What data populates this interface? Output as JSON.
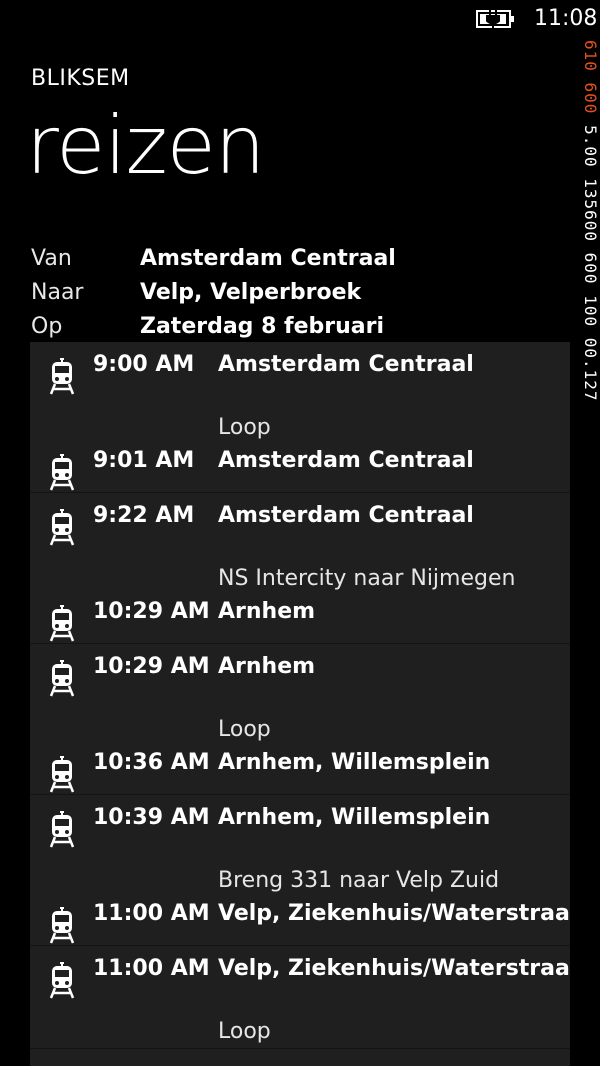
{
  "status": {
    "time": "11:08"
  },
  "side_debug": {
    "accent": "610 600 ",
    "normal": "5.00 135600 600 100 00.127 "
  },
  "app": {
    "name": "BLIKSEM",
    "title": "reizen"
  },
  "trip": {
    "from_label": "Van",
    "from_value": "Amsterdam Centraal",
    "to_label": "Naar",
    "to_value": "Velp, Velperbroek",
    "date_label": "Op",
    "date_value": "Zaterdag 8 februari"
  },
  "legs": [
    {
      "dep_time": "9:00 AM",
      "dep_stop": "Amsterdam Centraal",
      "mode": "Loop",
      "arr_time": "9:01 AM",
      "arr_stop": "Amsterdam Centraal"
    },
    {
      "dep_time": "9:22 AM",
      "dep_stop": "Amsterdam Centraal",
      "mode": "NS Intercity naar Nijmegen",
      "arr_time": "10:29 AM",
      "arr_stop": "Arnhem"
    },
    {
      "dep_time": "10:29 AM",
      "dep_stop": "Arnhem",
      "mode": "Loop",
      "arr_time": "10:36 AM",
      "arr_stop": "Arnhem, Willemsplein"
    },
    {
      "dep_time": "10:39 AM",
      "dep_stop": "Arnhem, Willemsplein",
      "mode": "Breng 331 naar Velp Zuid",
      "arr_time": "11:00 AM",
      "arr_stop": "Velp, Ziekenhuis/Waterstraat"
    },
    {
      "dep_time": "11:00 AM",
      "dep_stop": "Velp, Ziekenhuis/Waterstraat",
      "mode": "Loop"
    }
  ],
  "icons": {
    "transit": "train-icon",
    "battery": "battery-charging-icon"
  },
  "colors": {
    "background": "#000000",
    "panel": "#1f1f1f",
    "accent": "#e3501c"
  }
}
